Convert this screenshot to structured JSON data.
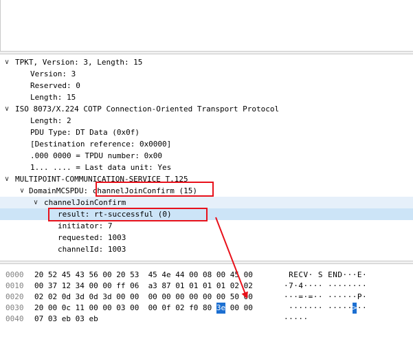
{
  "tree": [
    {
      "text": "TPKT, Version: 3, Length: 15",
      "level": 0,
      "arrow": "down"
    },
    {
      "text": "Version: 3",
      "level": 2
    },
    {
      "text": "Reserved: 0",
      "level": 2
    },
    {
      "text": "Length: 15",
      "level": 2
    },
    {
      "text": "ISO 8073/X.224 COTP Connection-Oriented Transport Protocol",
      "level": 0,
      "arrow": "down"
    },
    {
      "text": "Length: 2",
      "level": 2
    },
    {
      "text": "PDU Type: DT Data (0x0f)",
      "level": 2
    },
    {
      "text": "[Destination reference: 0x0000]",
      "level": 2
    },
    {
      "text": ".000 0000 = TPDU number: 0x00",
      "level": 2
    },
    {
      "text": "1... .... = Last data unit: Yes",
      "level": 2
    },
    {
      "text": "MULTIPOINT-COMMUNICATION-SERVICE T.125",
      "level": 0,
      "arrow": "down"
    },
    {
      "text": "DomainMCSPDU: channelJoinConfirm (15)",
      "level": 1,
      "arrow": "down"
    },
    {
      "text": "channelJoinConfirm",
      "level": 2,
      "arrow": "down",
      "highlight": true
    },
    {
      "text": "result: rt-successful (0)",
      "level": 3,
      "selected": true
    },
    {
      "text": "initiator: 7",
      "level": 3
    },
    {
      "text": "requested: 1003",
      "level": 3
    },
    {
      "text": "channelId: 1003",
      "level": 3
    }
  ],
  "bytes": [
    {
      "offset": "0000",
      "hex": "20 52 45 43 56 00 20 53  45 4e 44 00 08 00 45 00",
      "ascii": " RECV· S END···E·"
    },
    {
      "offset": "0010",
      "hex": "00 37 12 34 00 00 ff 06  a3 87 01 01 01 01 02 02",
      "ascii": "·7·4···· ········"
    },
    {
      "offset": "0020",
      "hex": "02 02 0d 3d 0d 3d 00 00  00 00 00 00 00 00 50 00",
      "ascii": "···=·=·· ······P·"
    },
    {
      "offset": "0030",
      "hex": "20 00 0c 11 00 00 03 00  00 0f 02 f0 80 3e 00 00",
      "ascii": " ······· ·····>··",
      "sel_hex": "3e",
      "sel_ascii": ">"
    },
    {
      "offset": "0040",
      "hex": "07 03 eb 03 eb",
      "ascii": "·····"
    }
  ]
}
